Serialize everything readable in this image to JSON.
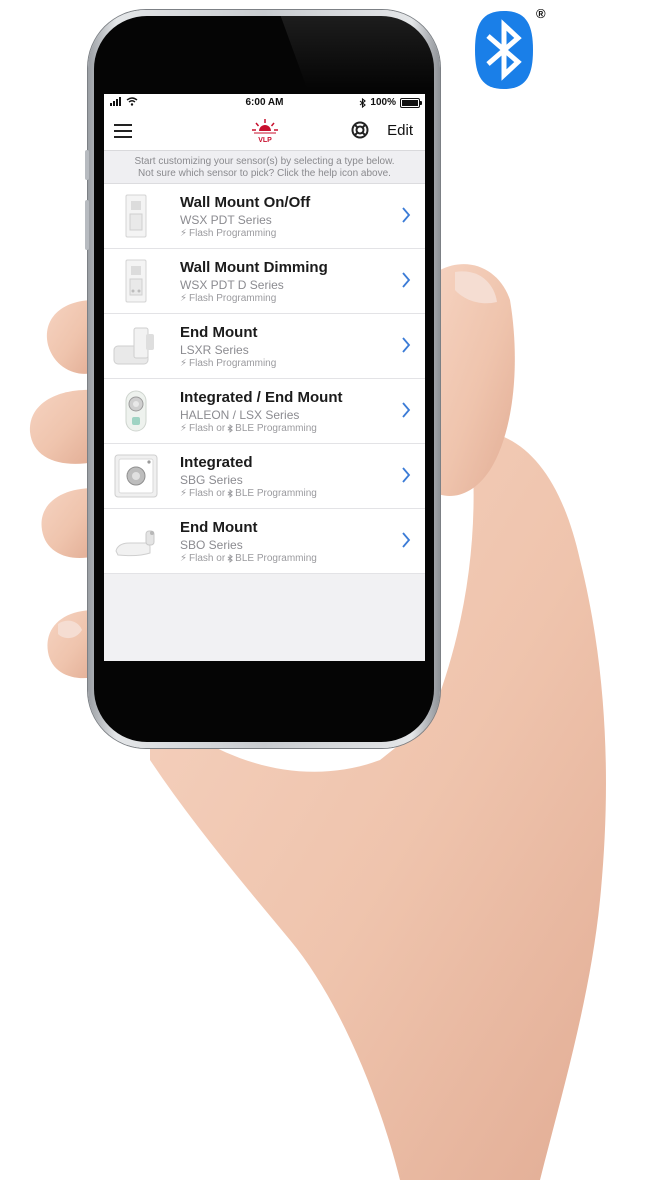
{
  "status_bar": {
    "time": "6:00 AM",
    "battery": "100%"
  },
  "nav": {
    "logo_text": "VLP",
    "edit_label": "Edit"
  },
  "hint": {
    "line1": "Start customizing your sensor(s) by selecting a type below.",
    "line2": "Not sure which sensor to pick? Click the help icon above."
  },
  "items": [
    {
      "title": "Wall Mount On/Off",
      "subtitle": "WSX PDT Series",
      "programming": "Flash Programming",
      "ble": false
    },
    {
      "title": "Wall Mount Dimming",
      "subtitle": "WSX PDT D Series",
      "programming": "Flash Programming",
      "ble": false
    },
    {
      "title": "End Mount",
      "subtitle": "LSXR Series",
      "programming": "Flash Programming",
      "ble": false
    },
    {
      "title": "Integrated / End Mount",
      "subtitle": "HALEON / LSX Series",
      "programming_prefix": "Flash or",
      "programming": "BLE Programming",
      "ble": true
    },
    {
      "title": "Integrated",
      "subtitle": "SBG Series",
      "programming_prefix": "Flash or",
      "programming": "BLE Programming",
      "ble": true
    },
    {
      "title": "End Mount",
      "subtitle": "SBO Series",
      "programming_prefix": "Flash or",
      "programming": "BLE Programming",
      "ble": true
    }
  ],
  "colors": {
    "accent": "#c8102e",
    "chevron": "#3b7bd6",
    "bluetooth": "#1a7fe8"
  },
  "icons": [
    "signal-icon",
    "wifi-icon",
    "bluetooth-icon",
    "battery-icon",
    "menu-icon",
    "vlp-logo",
    "help-icon",
    "lightning-icon",
    "chevron-right-icon"
  ]
}
